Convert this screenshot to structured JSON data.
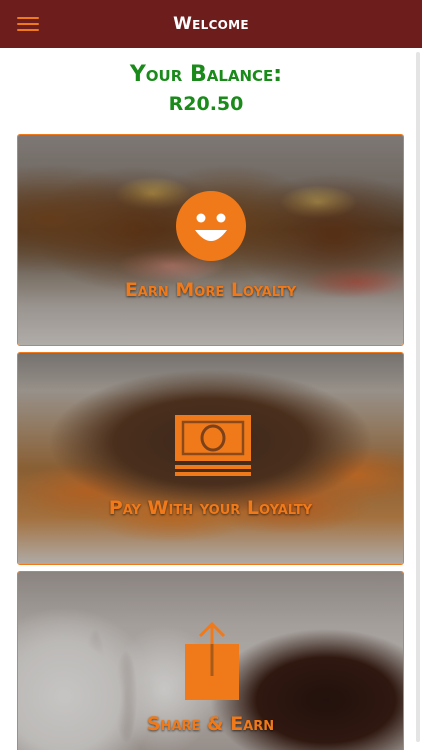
{
  "app_bar": {
    "title": "Welcome",
    "menu_icon": "hamburger-menu-icon",
    "background_color": "#6e1d1d",
    "accent_color": "#f07a1a"
  },
  "balance": {
    "label": "Your Balance:",
    "amount": "R20.50",
    "color": "#1a8a1a"
  },
  "cards": [
    {
      "label": "Earn More Loyalty",
      "icon": "smiley-icon"
    },
    {
      "label": "Pay With your Loyalty",
      "icon": "money-icon"
    },
    {
      "label": "Share & Earn",
      "icon": "share-icon"
    }
  ]
}
